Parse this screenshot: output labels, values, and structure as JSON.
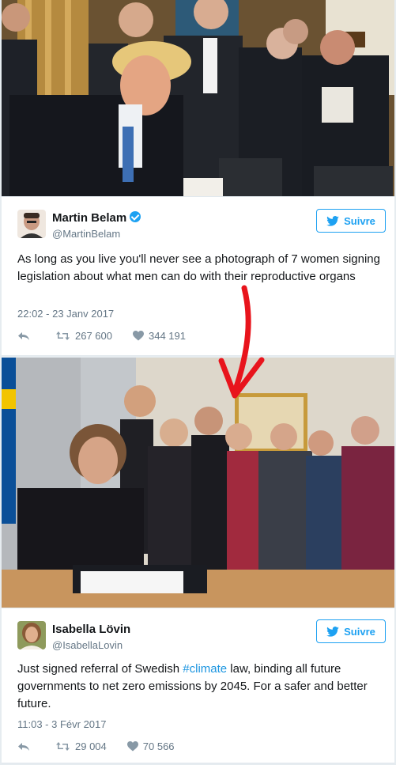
{
  "tweet1": {
    "name": "Martin Belam",
    "handle": "@MartinBelam",
    "follow_label": "Suivre",
    "text": "As long as you live you'll never see a photograph of 7 women signing legislation about what men can do with their reproductive organs",
    "time": "22:02 - 23 Janv 2017",
    "retweets": "267 600",
    "likes": "344 191"
  },
  "tweet2": {
    "name": "Isabella Lövin",
    "handle": "@IsabellaLovin",
    "follow_label": "Suivre",
    "text_before": "Just signed referral of Swedish ",
    "hashtag": "#climate",
    "text_after": " law, binding all future governments to net zero emissions by 2045. For a safer and better future.",
    "time": "11:03 - 3 Févr 2017",
    "retweets": "29 004",
    "likes": "70 566"
  },
  "colors": {
    "twitter_blue": "#1da1f2",
    "arrow_red": "#e8141c"
  },
  "icons": [
    "verified-icon",
    "twitter-bird-icon",
    "reply-icon",
    "retweet-icon",
    "heart-icon",
    "arrow-annotation"
  ]
}
